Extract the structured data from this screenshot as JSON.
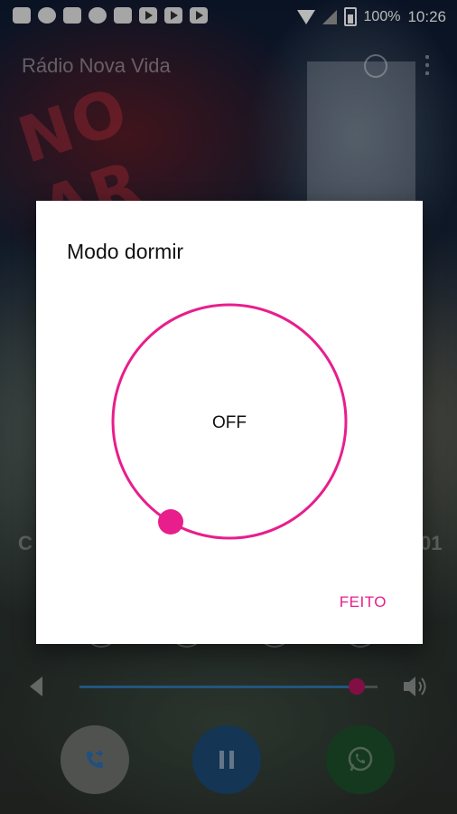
{
  "status_bar": {
    "battery": "100%",
    "time": "10:26"
  },
  "app_bar": {
    "title": "Rádio Nova Vida"
  },
  "background": {
    "banner_text": "NO AR",
    "side_left": "C",
    "side_right": "01",
    "volume_level": 0.93
  },
  "dialog": {
    "title": "Modo dormir",
    "timer_value": "OFF",
    "done_label": "FEITO",
    "accent_color": "#e81e8c"
  }
}
